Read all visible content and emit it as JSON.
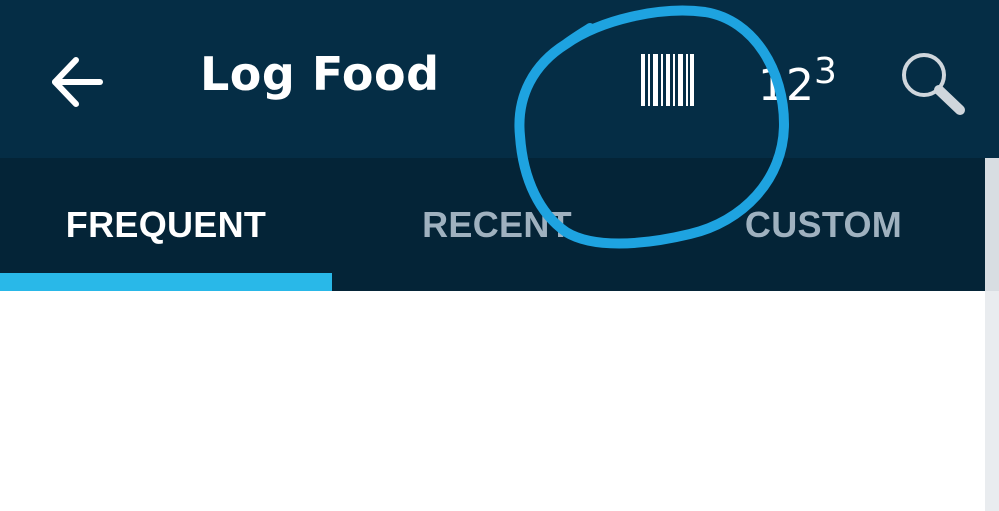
{
  "header": {
    "title": "Log Food",
    "back_icon": "arrow-left-icon",
    "barcode_icon": "barcode-icon",
    "manual_entry": {
      "base": "12",
      "superscript": "3"
    },
    "search_icon": "magnifier-icon"
  },
  "tabs": [
    {
      "label": "FREQUENT",
      "selected": true
    },
    {
      "label": "RECENT",
      "selected": false
    },
    {
      "label": "CUSTOM",
      "selected": false
    }
  ],
  "colors": {
    "toolbar": "#052d45",
    "tab_bar": "#042437",
    "accent": "#29b8e8",
    "annotation": "#1ea3e0"
  }
}
